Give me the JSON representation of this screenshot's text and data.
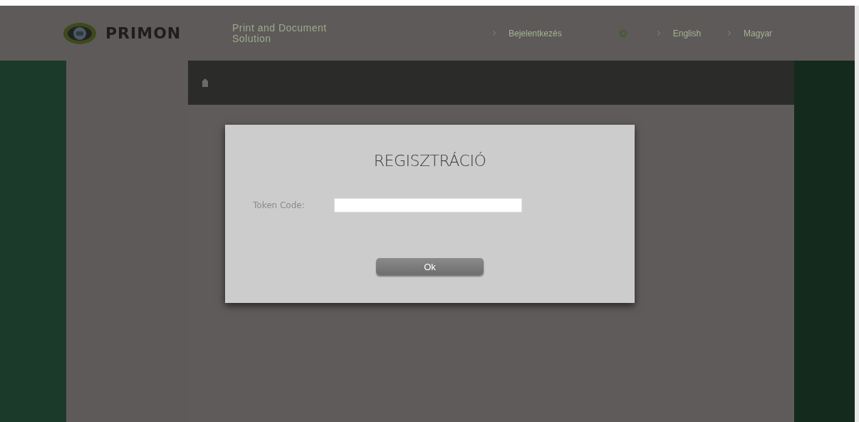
{
  "header": {
    "logo_text": "PRIMON",
    "tagline": "Print and Document Solution",
    "nav": [
      {
        "kind": "link",
        "label": "Bejelentkezés"
      },
      {
        "kind": "settings"
      },
      {
        "kind": "link",
        "label": "English"
      },
      {
        "kind": "link",
        "label": "Magyar"
      }
    ]
  },
  "dialog": {
    "title": "REGISZTRÁCIÓ",
    "field_label": "Token Code:",
    "button": "Ok"
  }
}
